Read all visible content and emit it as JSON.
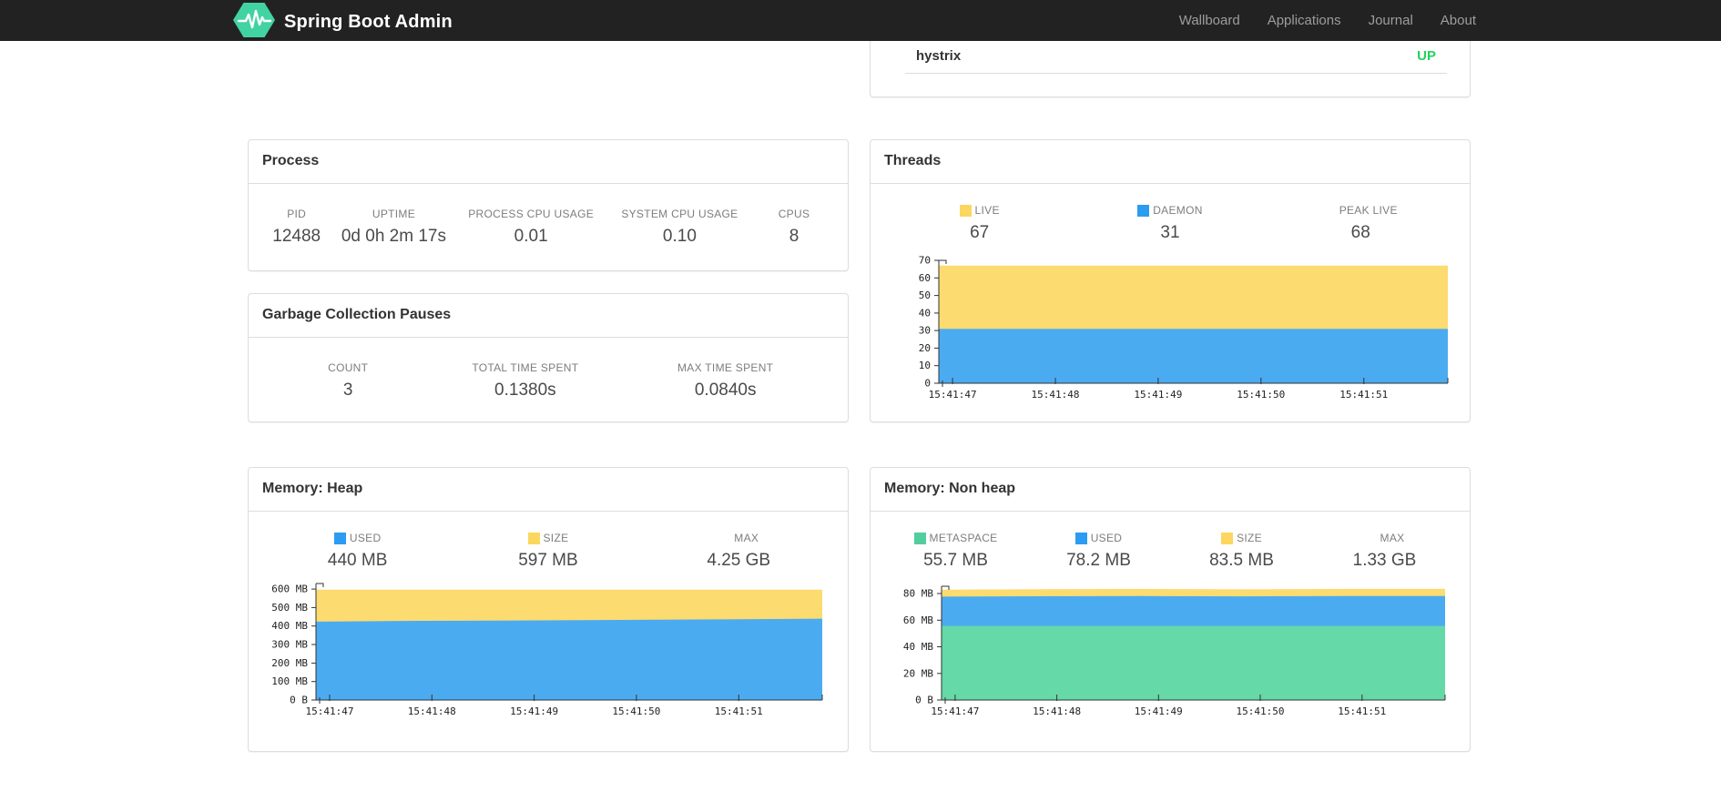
{
  "navbar": {
    "brand": "Spring Boot Admin",
    "bg_color": "#222222",
    "brand_color": "#ffffff",
    "link_color": "#9d9d9d",
    "logo_color": "#42d3a2",
    "items": [
      {
        "label": "Wallboard"
      },
      {
        "label": "Applications"
      },
      {
        "label": "Journal"
      },
      {
        "label": "About"
      }
    ]
  },
  "health_panel": {
    "row": {
      "name": "hystrix",
      "status": "UP",
      "status_color": "#21d35f"
    }
  },
  "panels": {
    "process": {
      "title": "Process",
      "stats": [
        {
          "label": "PID",
          "value": "12488"
        },
        {
          "label": "UPTIME",
          "value": "0d 0h 2m 17s"
        },
        {
          "label": "PROCESS CPU USAGE",
          "value": "0.01"
        },
        {
          "label": "SYSTEM CPU USAGE",
          "value": "0.10"
        },
        {
          "label": "CPUS",
          "value": "8"
        }
      ]
    },
    "gc": {
      "title": "Garbage Collection Pauses",
      "stats": [
        {
          "label": "COUNT",
          "value": "3"
        },
        {
          "label": "TOTAL TIME SPENT",
          "value": "0.1380s"
        },
        {
          "label": "MAX TIME SPENT",
          "value": "0.0840s"
        }
      ]
    },
    "threads": {
      "title": "Threads",
      "legend": [
        {
          "label": "LIVE",
          "swatch": "#fcd75f",
          "value": "67"
        },
        {
          "label": "DAEMON",
          "swatch": "#2b9cf2",
          "value": "31"
        },
        {
          "label": "PEAK LIVE",
          "swatch": null,
          "value": "68"
        }
      ]
    },
    "heap": {
      "title": "Memory: Heap",
      "legend": [
        {
          "label": "USED",
          "swatch": "#2b9cf2",
          "value": "440 MB"
        },
        {
          "label": "SIZE",
          "swatch": "#fcd75f",
          "value": "597 MB"
        },
        {
          "label": "MAX",
          "swatch": null,
          "value": "4.25 GB"
        }
      ]
    },
    "nonheap": {
      "title": "Memory: Non heap",
      "legend": [
        {
          "label": "METASPACE",
          "swatch": "#52ce9e",
          "value": "55.7 MB"
        },
        {
          "label": "USED",
          "swatch": "#2b9cf2",
          "value": "78.2 MB"
        },
        {
          "label": "SIZE",
          "swatch": "#fcd75f",
          "value": "83.5 MB"
        },
        {
          "label": "MAX",
          "swatch": null,
          "value": "1.33 GB"
        }
      ]
    }
  },
  "chart_data": [
    {
      "id": "threads",
      "type": "area",
      "title": "Threads",
      "x": [
        "15:41:47",
        "15:41:48",
        "15:41:49",
        "15:41:50",
        "15:41:51"
      ],
      "ylim": [
        0,
        70
      ],
      "yticks": [
        {
          "value": 0,
          "label": "0"
        },
        {
          "value": 10,
          "label": "10"
        },
        {
          "value": 20,
          "label": "20"
        },
        {
          "value": 30,
          "label": "30"
        },
        {
          "value": 40,
          "label": "40"
        },
        {
          "value": 50,
          "label": "50"
        },
        {
          "value": 60,
          "label": "60"
        },
        {
          "value": 70,
          "label": "70"
        }
      ],
      "series": [
        {
          "name": "LIVE",
          "color": "#fcdb70",
          "values": [
            67,
            67,
            67,
            67,
            67,
            67
          ]
        },
        {
          "name": "DAEMON",
          "color": "#4babf0",
          "values": [
            31,
            31,
            31,
            31,
            31,
            31
          ]
        }
      ],
      "annotations": {
        "peak_live": 68
      },
      "grid": false,
      "legend_position": "top"
    },
    {
      "id": "heap",
      "type": "area",
      "title": "Memory: Heap",
      "x": [
        "15:41:47",
        "15:41:48",
        "15:41:49",
        "15:41:50",
        "15:41:51"
      ],
      "ylim": [
        0,
        630
      ],
      "ylabel_unit": "MB",
      "yticks": [
        {
          "value": 0,
          "label": "0 B"
        },
        {
          "value": 100,
          "label": "100 MB"
        },
        {
          "value": 200,
          "label": "200 MB"
        },
        {
          "value": 300,
          "label": "300 MB"
        },
        {
          "value": 400,
          "label": "400 MB"
        },
        {
          "value": 500,
          "label": "500 MB"
        },
        {
          "value": 600,
          "label": "600 MB"
        }
      ],
      "series": [
        {
          "name": "SIZE",
          "color": "#fcdb70",
          "values": [
            597,
            597,
            597,
            597,
            597,
            597
          ]
        },
        {
          "name": "USED",
          "color": "#4babf0",
          "values": [
            424,
            428,
            430,
            433,
            436,
            440
          ]
        }
      ],
      "annotations": {
        "max": "4.25 GB"
      },
      "grid": false,
      "legend_position": "top"
    },
    {
      "id": "nonheap",
      "type": "area",
      "title": "Memory: Non heap",
      "x": [
        "15:41:47",
        "15:41:48",
        "15:41:49",
        "15:41:50",
        "15:41:51"
      ],
      "ylim": [
        0,
        85.5
      ],
      "ylabel_unit": "MB",
      "yticks": [
        {
          "value": 0,
          "label": "0 B"
        },
        {
          "value": 20,
          "label": "20 MB"
        },
        {
          "value": 40,
          "label": "40 MB"
        },
        {
          "value": 60,
          "label": "60 MB"
        },
        {
          "value": 80,
          "label": "80 MB"
        }
      ],
      "series": [
        {
          "name": "SIZE",
          "color": "#fcdb70",
          "values": [
            83.0,
            83.3,
            83.5,
            83.2,
            83.5,
            83.5
          ]
        },
        {
          "name": "USED",
          "color": "#4babf0",
          "values": [
            77.7,
            78.0,
            78.1,
            77.9,
            78.2,
            78.2
          ]
        },
        {
          "name": "METASPACE",
          "color": "#65d9a8",
          "values": [
            55.7,
            55.7,
            55.7,
            55.7,
            55.7,
            55.7
          ]
        }
      ],
      "annotations": {
        "max": "1.33 GB"
      },
      "grid": false,
      "legend_position": "top"
    }
  ]
}
